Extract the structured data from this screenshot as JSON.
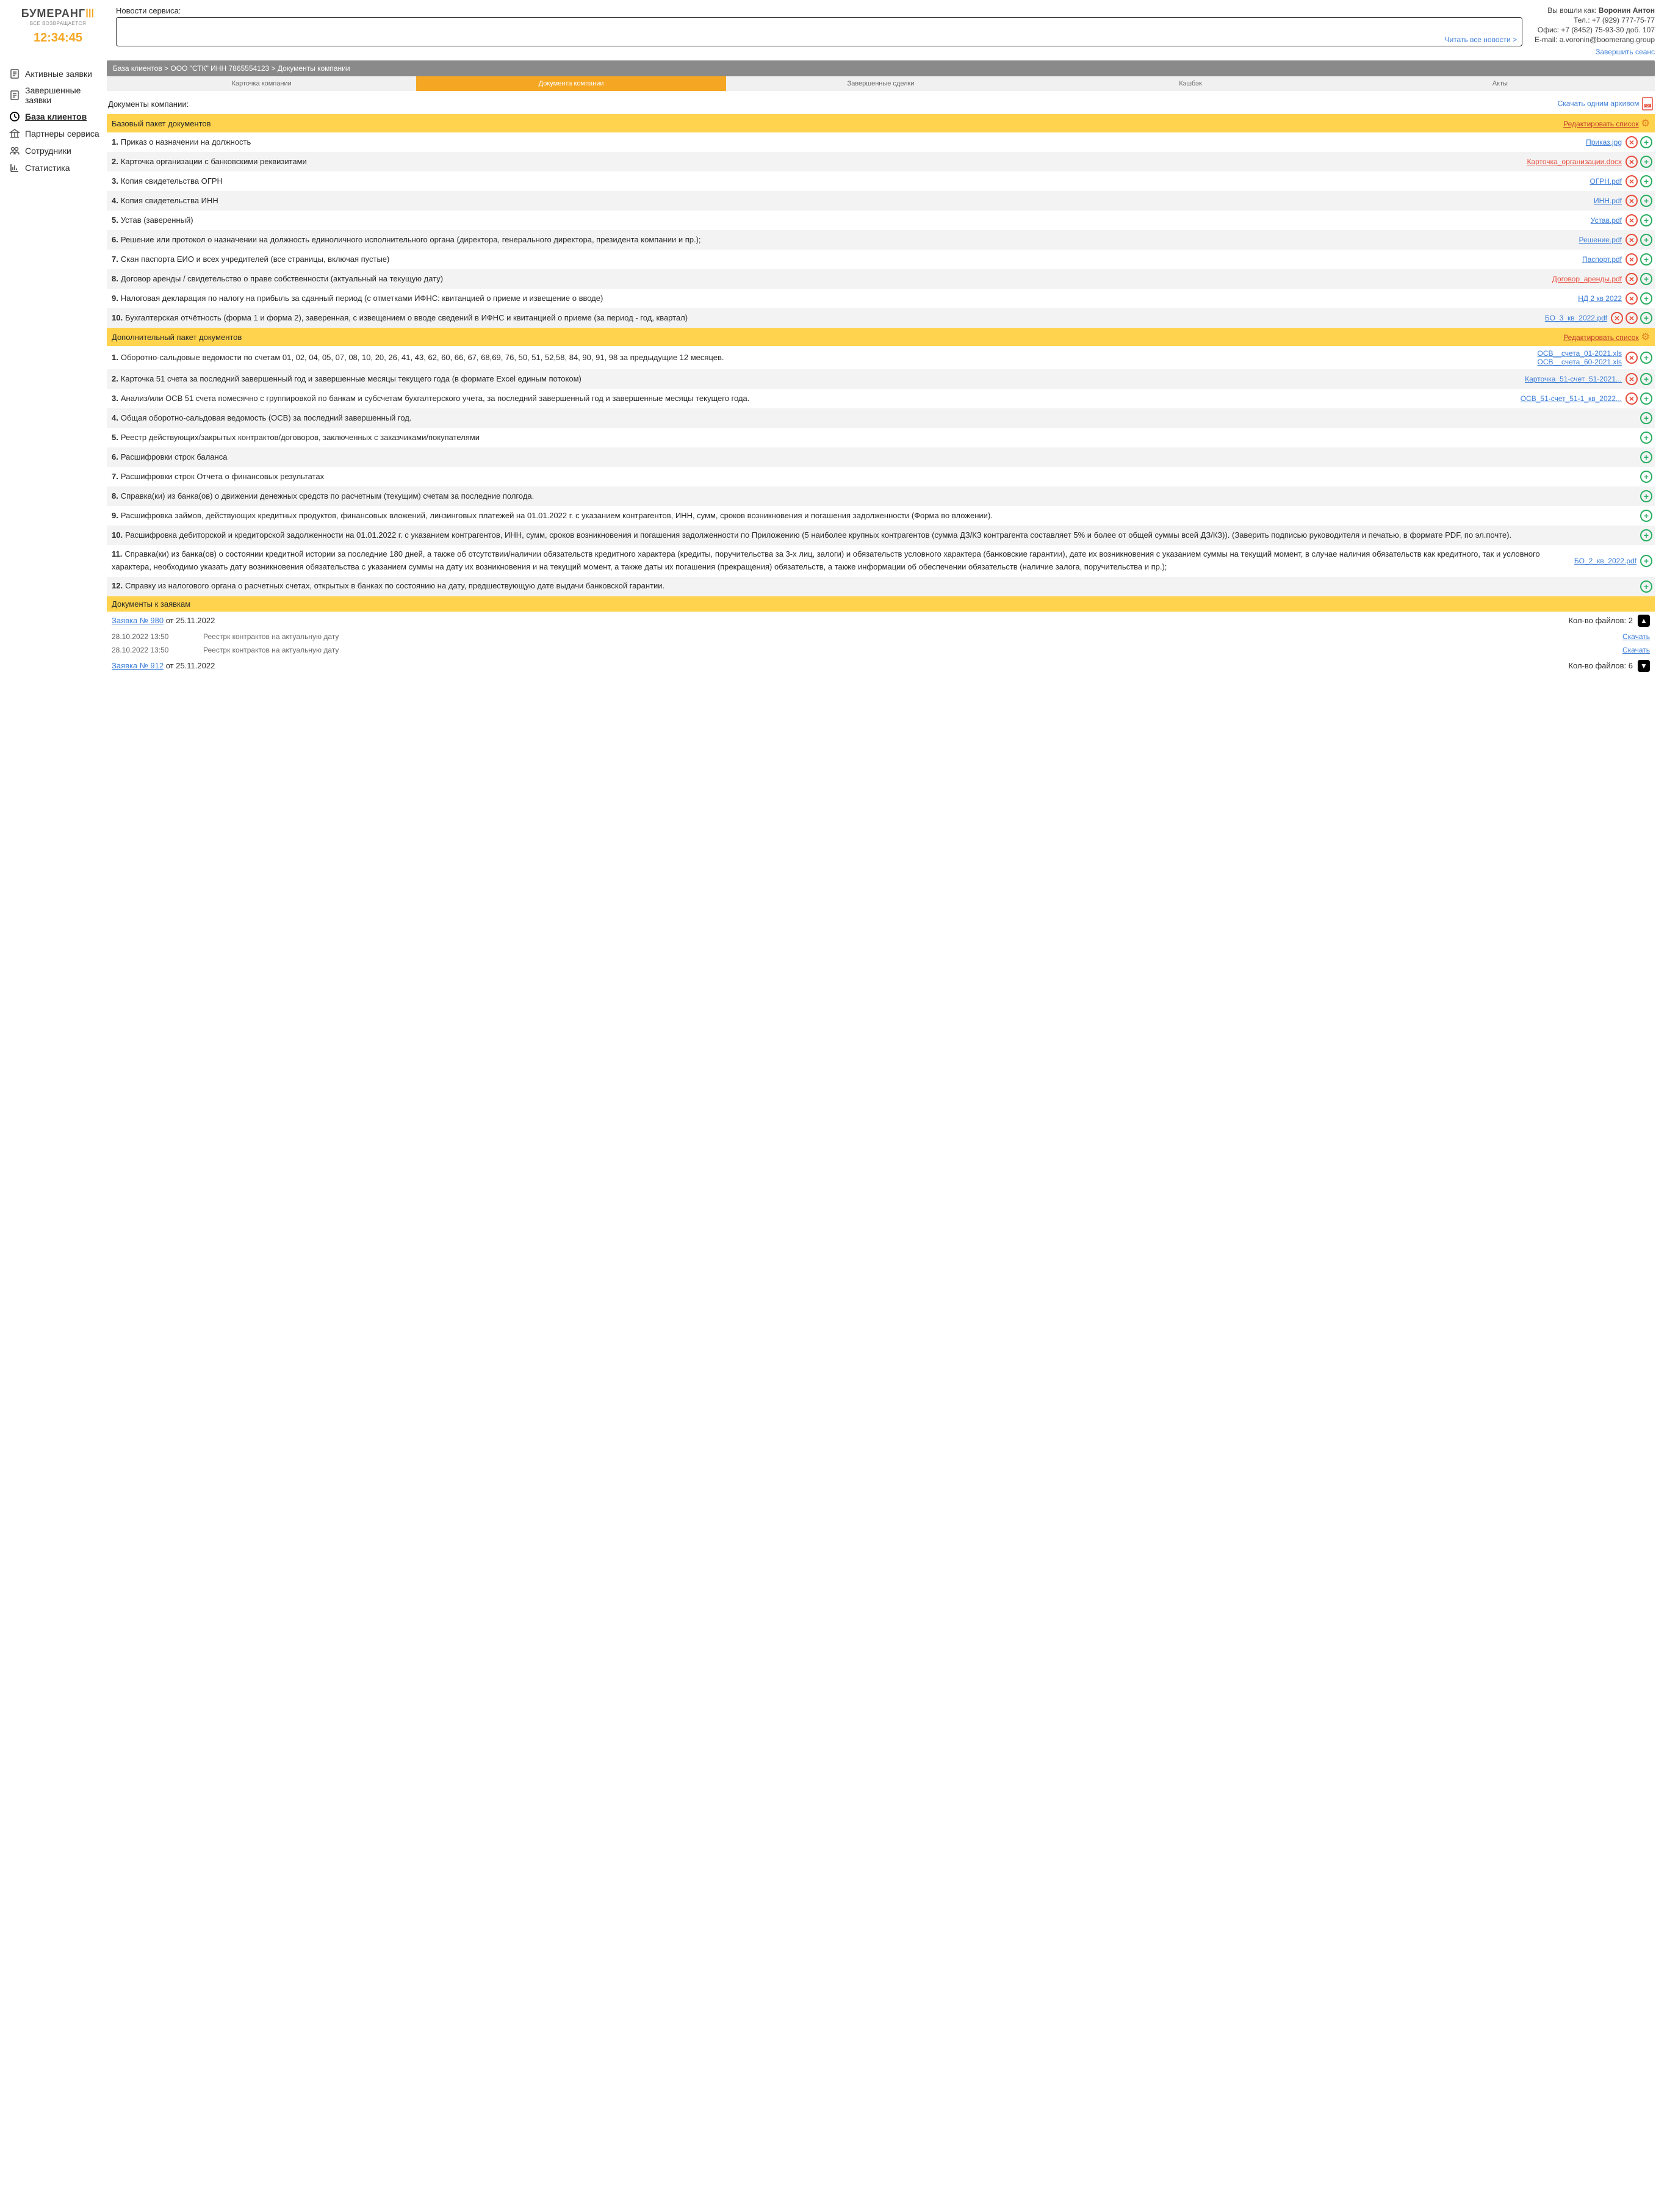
{
  "header": {
    "logo": "БУМЕРАНГ",
    "logo_sub": "ВСЁ ВОЗВРАЩАЕТСЯ",
    "clock": "12:34:45",
    "news_label": "Новости сервиса:",
    "news_link": "Читать все новости >",
    "login_prefix": "Вы вошли как:",
    "user": "Воронин Антон",
    "tel": "Тел.: +7 (929) 777-75-77",
    "office": "Офис: +7 (8452) 75-93-30 доб. 107",
    "email": "E-mail: a.voronin@boomerang.group",
    "logout": "Завершить сеанс"
  },
  "nav": [
    {
      "k": "doc",
      "l": "Активные заявки"
    },
    {
      "k": "doc",
      "l": "Завершенные заявки"
    },
    {
      "k": "clock",
      "l": "База клиентов",
      "active": true
    },
    {
      "k": "bank",
      "l": "Партнеры сервиса"
    },
    {
      "k": "users",
      "l": "Сотрудники"
    },
    {
      "k": "chart",
      "l": "Статистика"
    }
  ],
  "breadcrumb": "База клиентов > ООО \"СТК\" ИНН 7865554123 > Документы компании",
  "tabs": [
    "Карточка компании",
    "Документа компании",
    "Завершенные сделки",
    "Кэшбэк",
    "Акты"
  ],
  "tab_active": 1,
  "section": {
    "title": "Документы компании:",
    "download": "Скачать одним архивом"
  },
  "pkg1": {
    "title": "Базовый пакет документов",
    "edit": "Редактировать список"
  },
  "rows1": [
    {
      "n": "1.",
      "t": "Приказ о назначении на должность",
      "f": [
        {
          "l": "Приказ.jpg"
        }
      ],
      "del": 1,
      "add": 1
    },
    {
      "n": "2.",
      "t": "Карточка организации с банковскими реквизитами",
      "f": [
        {
          "l": "Карточка_организации.docx",
          "red": 1
        }
      ],
      "del": 1,
      "add": 1,
      "alt": 1
    },
    {
      "n": "3.",
      "t": "Копия свидетельства ОГРН",
      "f": [
        {
          "l": "ОГРН.pdf"
        }
      ],
      "del": 1,
      "add": 1
    },
    {
      "n": "4.",
      "t": "Копия свидетельства ИНН",
      "f": [
        {
          "l": "ИНН.pdf"
        }
      ],
      "del": 1,
      "add": 1,
      "alt": 1
    },
    {
      "n": "5.",
      "t": "Устав (заверенный)",
      "f": [
        {
          "l": "Устав.pdf"
        }
      ],
      "del": 1,
      "add": 1
    },
    {
      "n": "6.",
      "t": "Решение или протокол о назначении на должность единоличного исполнительного органа (директора, генерального директора, президента компании и пр.);",
      "f": [
        {
          "l": "Решение.pdf"
        }
      ],
      "del": 1,
      "add": 1,
      "alt": 1
    },
    {
      "n": "7.",
      "t": "Скан паспорта ЕИО и всех учредителей (все страницы, включая пустые)",
      "f": [
        {
          "l": "Паспорт.pdf"
        }
      ],
      "del": 1,
      "add": 1
    },
    {
      "n": "8.",
      "t": "Договор аренды / свидетельство о праве собственности (актуальный на текущую дату)",
      "f": [
        {
          "l": "Договор_аренды.pdf",
          "red": 1
        }
      ],
      "del": 1,
      "add": 1,
      "alt": 1
    },
    {
      "n": "9.",
      "t": "Налоговая декларация по налогу на прибыль за сданный период (с отметками ИФНС: квитанцией о приеме и извещение о вводе)",
      "f": [
        {
          "l": "НД 2 кв 2022"
        }
      ],
      "del": 1,
      "add": 1
    },
    {
      "n": "10.",
      "t": "Бухгалтерская отчётность (форма 1 и форма 2), заверенная, с извещением о вводе сведений в ИФНС и квитанцией о приеме (за период - год, квартал)",
      "f": [
        {
          "l": "БО_3_кв_2022.pdf"
        }
      ],
      "del": 2,
      "add": 1,
      "alt": 1
    }
  ],
  "pkg2": {
    "title": "Дополнительный пакет документов",
    "edit": "Редактировать список"
  },
  "rows2": [
    {
      "n": "1.",
      "t": "Оборотно-сальдовые ведомости по счетам 01, 02, 04, 05, 07, 08, 10, 20, 26, 41, 43, 62, 60, 66, 67, 68,69, 76, 50, 51, 52,58, 84, 90, 91, 98 за предыдущие 12 месяцев.",
      "f": [
        {
          "l": "ОСВ__счета_01-2021.xls "
        },
        {
          "l": "ОСВ__счета_60-2021.xls"
        }
      ],
      "del": 1,
      "add": 1
    },
    {
      "n": "2.",
      "t": "Карточка 51 счета за последний завершенный год и завершенные месяцы текущего года (в формате Excel единым потоком)",
      "f": [
        {
          "l": "Карточка_51-счет_51-2021..."
        }
      ],
      "del": 1,
      "add": 1,
      "alt": 1
    },
    {
      "n": "3.",
      "t": "Анализ/или ОСВ 51 счета помесячно с группировкой по банкам и субсчетам бухгалтерского учета, за последний завершенный год и завершенные месяцы текущего года.",
      "f": [
        {
          "l": "ОСВ_51-счет_51-1_кв_2022..."
        }
      ],
      "del": 1,
      "add": 1
    },
    {
      "n": "4.",
      "t": "Общая оборотно-сальдовая ведомость (ОСВ) за последний завершенный год.",
      "add": 1,
      "alt": 1
    },
    {
      "n": "5.",
      "t": "Реестр действующих/закрытых контрактов/договоров, заключенных с заказчиками/покупателями",
      "add": 1
    },
    {
      "n": "6.",
      "t": "Расшифровки строк баланса",
      "add": 1,
      "alt": 1
    },
    {
      "n": "7.",
      "t": "Расшифровки строк Отчета о финансовых результатах",
      "add": 1
    },
    {
      "n": "8.",
      "t": "Справка(ки) из банка(ов) о движении денежных средств по расчетным (текущим) счетам за последние полгода.",
      "add": 1,
      "alt": 1
    },
    {
      "n": "9.",
      "t": "Расшифровка займов, действующих кредитных продуктов, финансовых вложений, линзинговых платежей на 01.01.2022 г. с указанием контрагентов, ИНН, сумм, сроков возникновения и погашения задолженности (Форма во вложении).",
      "add": 1
    },
    {
      "n": "10.",
      "t": "Расшифровка дебиторской и кредиторской задолженности на 01.01.2022 г. с указанием контрагентов, ИНН, сумм, сроков возникновения и погашения задолженности по Приложению (5 наиболее крупных контрагентов (сумма ДЗ/КЗ контрагента составляет 5% и более от общей суммы всей ДЗ/КЗ)). (Заверить подписью руководителя и печатью, в формате PDF, по эл.почте).",
      "add": 1,
      "alt": 1
    },
    {
      "n": "11.",
      "t": "Справка(ки) из банка(ов) о состоянии кредитной истории за последние 180 дней, а также об отсутствии/наличии обязательств кредитного характера (кредиты, поручительства за 3-х лиц, залоги) и обязательств условного характера (банковские гарантии), дате их возникновения с указанием суммы на текущий момент, в случае наличия обязательств как кредитного, так и условного характера, необходимо указать дату возникновения обязательства с указанием суммы на дату их возникновения и на текущий момент, а также даты их погашения (прекращения) обязательств, а также информации об обеспечении обязательств (наличие залога, поручительства и пр.);",
      "f": [
        {
          "l": "БО_2_кв_2022.pdf"
        }
      ],
      "add": 1
    },
    {
      "n": "12.",
      "t": "Справку из налогового органа о расчетных счетах, открытых в банках по состоянию на дату, предшествующую дате выдачи банковской гарантии.",
      "add": 1,
      "alt": 1
    }
  ],
  "apps": {
    "title": "Документы к заявкам"
  },
  "reqs": [
    {
      "link": "Заявка № 980",
      "date": " от 25.11.2022",
      "count": "Кол-во файлов: 2",
      "arrow": "up",
      "files": [
        {
          "d": "28.10.2022 13:50",
          "n": "Реестрк контрактов на актуальную дату",
          "dl": "Скачать"
        },
        {
          "d": "28.10.2022 13:50",
          "n": "Реестрк контрактов на актуальную дату",
          "dl": "Скачать"
        }
      ]
    },
    {
      "link": "Заявка № 912",
      "date": " от 25.11.2022",
      "count": "Кол-во файлов: 6",
      "arrow": "down"
    }
  ]
}
